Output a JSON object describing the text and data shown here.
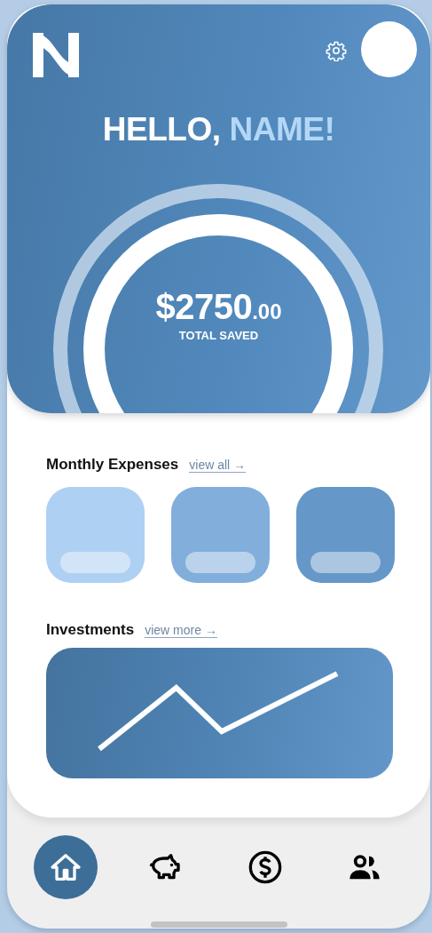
{
  "header": {
    "greeting": "HELLO,",
    "name": "NAME!",
    "amount": "$2750",
    "amount_cents": ".00",
    "amount_label": "TOTAL SAVED"
  },
  "monthly_expenses": {
    "title": "Monthly Expenses",
    "link": "view all →",
    "cards": [
      {
        "color": "#aed0f3"
      },
      {
        "color": "#82aedb"
      },
      {
        "color": "#6597c8"
      }
    ]
  },
  "investments": {
    "title": "Investments",
    "link": "view more →"
  },
  "nav": [
    {
      "kind": "home",
      "selected": true
    },
    {
      "kind": "savings",
      "selected": false
    },
    {
      "kind": "money",
      "selected": false
    },
    {
      "kind": "people",
      "selected": false
    }
  ]
}
